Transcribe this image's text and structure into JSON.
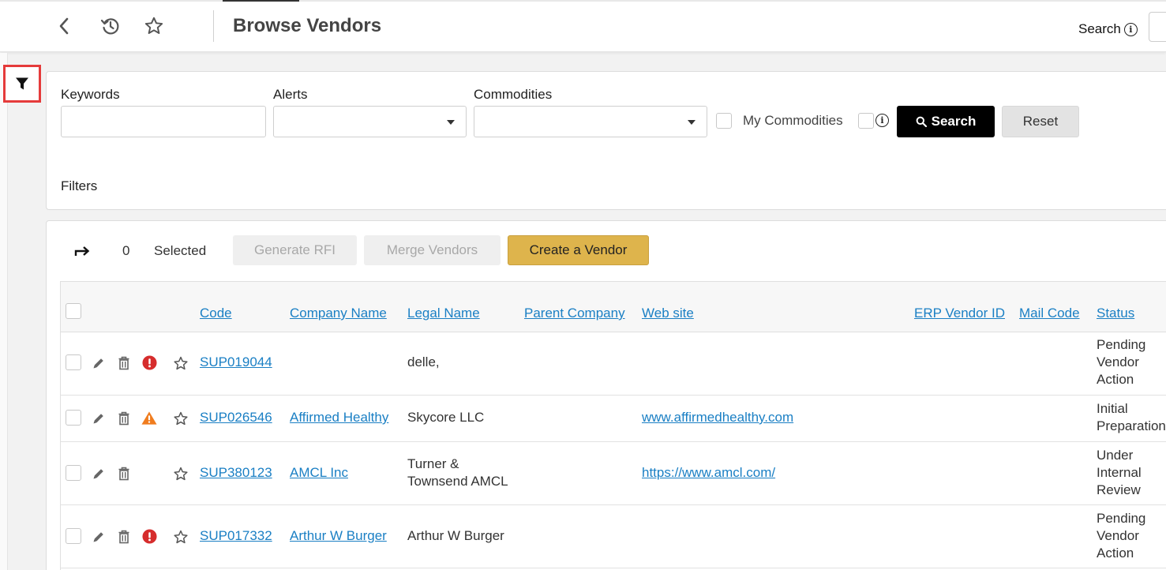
{
  "header": {
    "title": "Browse Vendors",
    "search_label": "Search"
  },
  "filter_panel": {
    "keywords_label": "Keywords",
    "keywords_value": "",
    "alerts_label": "Alerts",
    "alerts_value": "",
    "commodities_label": "Commodities",
    "commodities_value": "",
    "my_commodities_label": "My Commodities",
    "search_button": "Search",
    "reset_button": "Reset",
    "filters_title": "Filters"
  },
  "toolbar": {
    "selected_count": "0",
    "selected_label": "Selected",
    "generate_rfi": "Generate RFI",
    "merge_vendors": "Merge Vendors",
    "create_vendor": "Create a Vendor"
  },
  "table": {
    "columns": [
      "Code",
      "Company Name",
      "Legal Name",
      "Parent Company",
      "Web site",
      "ERP Vendor ID",
      "Mail Code",
      "Status"
    ],
    "rows": [
      {
        "alert": "error",
        "code": "SUP019044",
        "company": "",
        "legal_1": "delle,",
        "legal_2": "",
        "website": "",
        "status_1": "Pending",
        "status_2": "Vendor",
        "status_3": "Action"
      },
      {
        "alert": "warning",
        "code": "SUP026546",
        "company": "Affirmed Healthy",
        "legal_1": "Skycore LLC",
        "legal_2": "",
        "website": "www.affirmedhealthy.com",
        "status_1": "Initial",
        "status_2": "Preparation",
        "status_3": ""
      },
      {
        "alert": "none",
        "code": "SUP380123",
        "company": "AMCL Inc",
        "legal_1": "Turner &",
        "legal_2": "Townsend AMCL",
        "website": "https://www.amcl.com/",
        "status_1": "Under",
        "status_2": "Internal",
        "status_3": "Review"
      },
      {
        "alert": "error",
        "code": "SUP017332",
        "company": "Arthur W Burger",
        "legal_1": "Arthur W Burger",
        "legal_2": "",
        "website": "",
        "status_1": "Pending",
        "status_2": "Vendor",
        "status_3": "Action"
      }
    ]
  },
  "colors": {
    "link": "#1a7fc4",
    "error": "#d62d2d",
    "warning": "#f07c1e",
    "create_button": "#deb44c",
    "highlight": "#e53b3b"
  }
}
